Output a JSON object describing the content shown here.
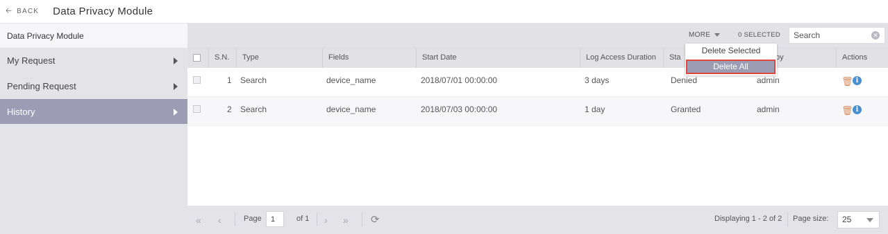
{
  "header": {
    "back_label": "BACK",
    "title": "Data Privacy Module"
  },
  "sidebar": {
    "heading": "Data Privacy Module",
    "items": [
      {
        "label": "My Request"
      },
      {
        "label": "Pending Request"
      },
      {
        "label": "History"
      }
    ]
  },
  "toolbar": {
    "more_label": "MORE",
    "selected_label": "0 SELECTED",
    "search_placeholder": "Search"
  },
  "dropdown": {
    "items": [
      "Delete Selected",
      "Delete All"
    ]
  },
  "table": {
    "columns": [
      "S.N.",
      "Type",
      "Fields",
      "Start Date",
      "Log Access Duration",
      "Sta",
      "ested by",
      "Actions"
    ],
    "rows": [
      {
        "sn": "1",
        "type": "Search",
        "fields": "device_name",
        "start": "2018/07/01 00:00:00",
        "duration": "3 days",
        "status": "Denied",
        "by": "admin"
      },
      {
        "sn": "2",
        "type": "Search",
        "fields": "device_name",
        "start": "2018/07/03 00:00:00",
        "duration": "1 day",
        "status": "Granted",
        "by": "admin"
      }
    ]
  },
  "footer": {
    "page_label": "Page",
    "page_value": "1",
    "of_label": "of 1",
    "displaying": "Displaying 1 - 2 of 2",
    "page_size_label": "Page size:",
    "page_size_value": "25"
  },
  "colors": {
    "active_nav": "#9c9cb4",
    "highlight_border": "#e0463a",
    "info_icon": "#4a8fd0",
    "trash_icon": "#d98a5c"
  }
}
